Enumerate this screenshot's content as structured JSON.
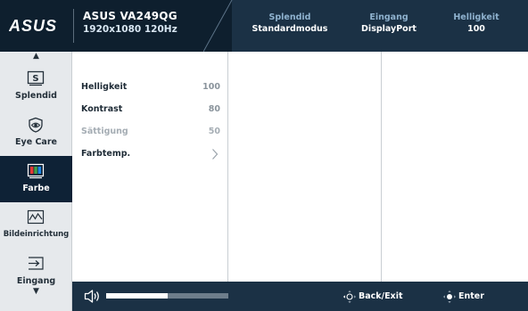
{
  "header": {
    "brand": "ASUS",
    "model": "ASUS VA249QG",
    "resolution": "1920x1080 120Hz",
    "stats": [
      {
        "label": "Splendid",
        "value": "Standardmodus"
      },
      {
        "label": "Eingang",
        "value": "DisplayPort"
      },
      {
        "label": "Helligkeit",
        "value": "100"
      }
    ]
  },
  "sidebar": {
    "items": [
      {
        "label": "Splendid",
        "icon": "splendid-icon",
        "active": false
      },
      {
        "label": "Eye Care",
        "icon": "eye-icon",
        "active": false
      },
      {
        "label": "Farbe",
        "icon": "color-bars-icon",
        "active": true
      },
      {
        "label": "Bildeinrichtung",
        "icon": "waveform-icon",
        "active": false
      },
      {
        "label": "Eingang",
        "icon": "input-arrow-icon",
        "active": false
      }
    ],
    "up_arrow": "▲",
    "down_arrow": "▼"
  },
  "menu": {
    "items": [
      {
        "label": "Helligkeit",
        "value": "100",
        "enabled": true
      },
      {
        "label": "Kontrast",
        "value": "80",
        "enabled": true
      },
      {
        "label": "Sättigung",
        "value": "50",
        "enabled": false
      },
      {
        "label": "Farbtemp.",
        "value": "",
        "enabled": true,
        "has_submenu": true
      }
    ]
  },
  "footer": {
    "volume_fraction": 0.5,
    "back_label": "Back/Exit",
    "enter_label": "Enter"
  },
  "colors": {
    "header_bg": "#1b3145",
    "accent_dark": "#0e2236",
    "sidebar_bg": "#e6e9ec"
  }
}
